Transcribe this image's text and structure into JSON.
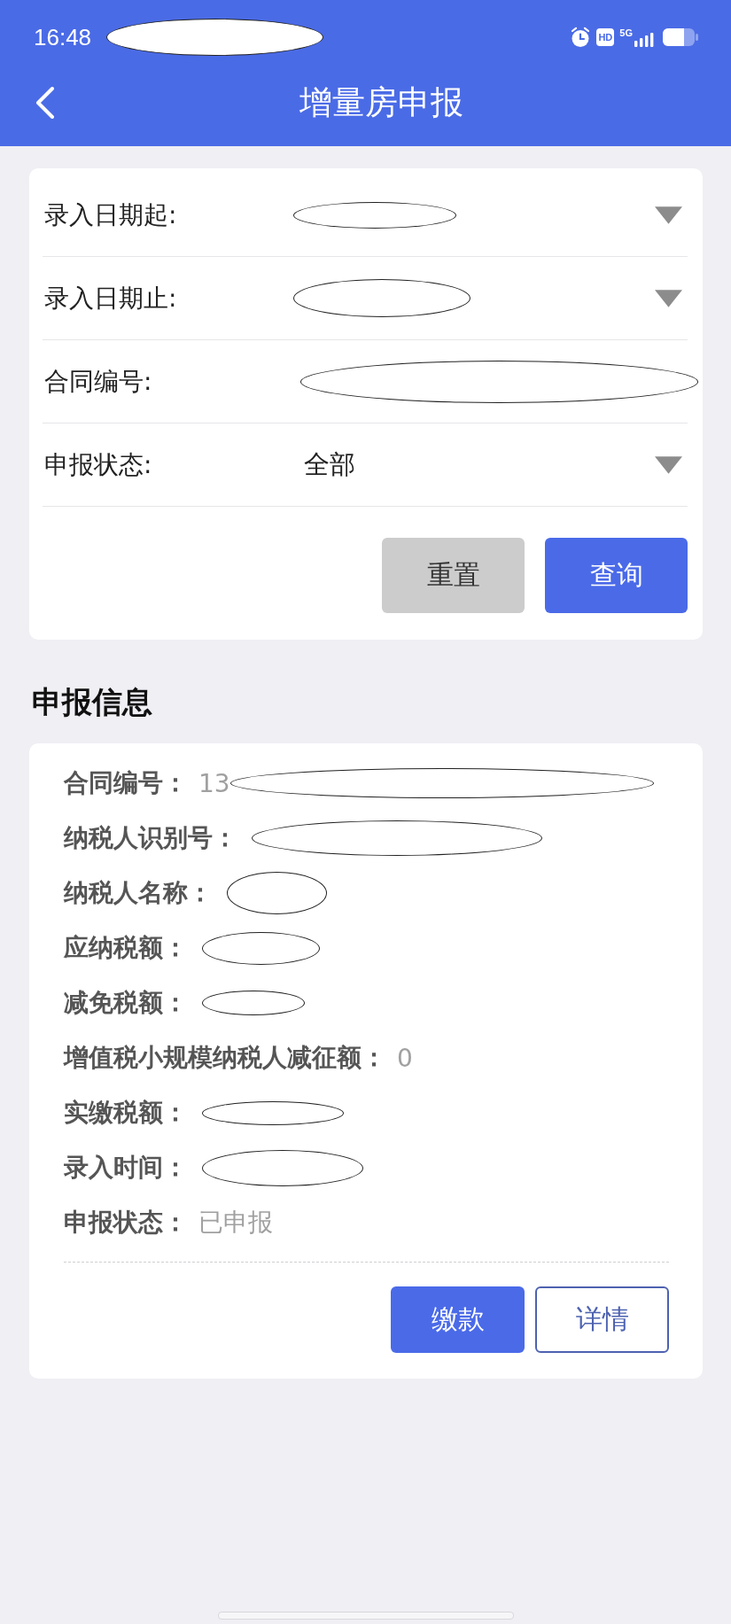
{
  "status_bar": {
    "time": "16:48",
    "redacted": true,
    "hd_badge": "HD",
    "network": "5G"
  },
  "header": {
    "title": "增量房申报"
  },
  "filter": {
    "fields": [
      {
        "label": "录入日期起:",
        "kind": "select",
        "redacted": true
      },
      {
        "label": "录入日期止:",
        "kind": "select",
        "redacted": true
      },
      {
        "label": "合同编号:",
        "kind": "input",
        "redacted": true
      },
      {
        "label": "申报状态:",
        "kind": "select",
        "value": "全部",
        "redacted": false
      }
    ],
    "buttons": [
      {
        "label": "重置",
        "kind": "secondary"
      },
      {
        "label": "查询",
        "kind": "primary"
      }
    ]
  },
  "section_title": "申报信息",
  "record": {
    "fields": [
      {
        "label": "合同编号：",
        "value": "13",
        "redacted": true
      },
      {
        "label": "纳税人识别号：",
        "redacted": true
      },
      {
        "label": "纳税人名称：",
        "redacted": true
      },
      {
        "label": "应纳税额：",
        "redacted": true
      },
      {
        "label": "减免税额：",
        "redacted": true
      },
      {
        "label": "增值税小规模纳税人减征额：",
        "value": "0",
        "redacted": false
      },
      {
        "label": "实缴税额：",
        "redacted": true
      },
      {
        "label": "录入时间：",
        "redacted": true
      },
      {
        "label": "申报状态：",
        "value": "已申报",
        "redacted": false
      }
    ],
    "buttons": [
      {
        "label": "缴款",
        "kind": "primary"
      },
      {
        "label": "详情",
        "kind": "outline"
      }
    ]
  }
}
